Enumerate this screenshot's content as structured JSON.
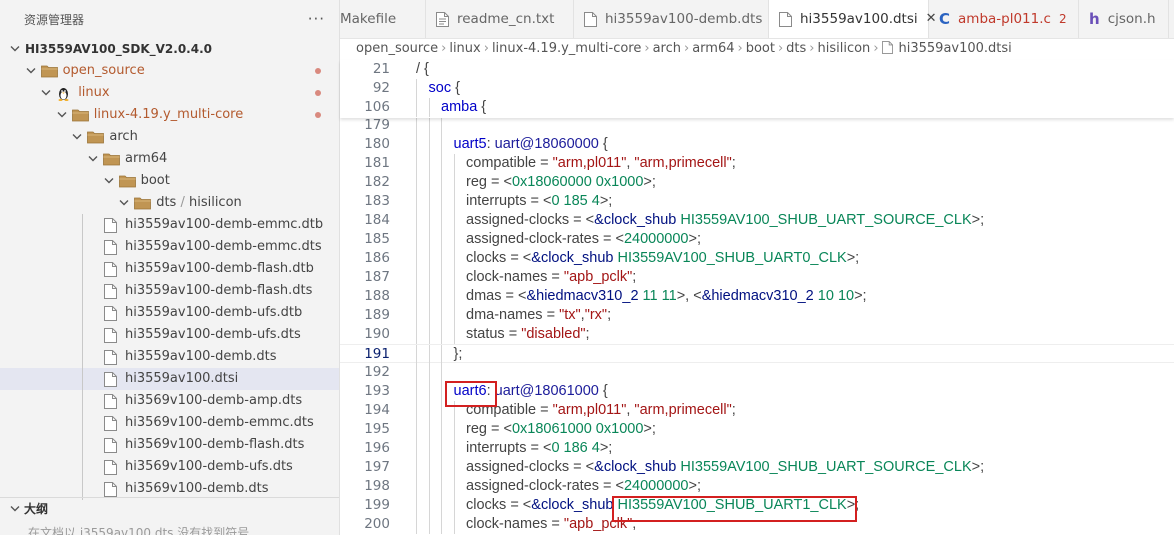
{
  "sidebar": {
    "title": "资源管理器",
    "more": "···",
    "tree": [
      {
        "label": "HI3559AV100_SDK_V2.0.4.0",
        "level": 0,
        "type": "root",
        "expanded": true
      },
      {
        "label": "open_source",
        "level": 1,
        "type": "folder",
        "expanded": true,
        "modified": true
      },
      {
        "label": "linux",
        "level": 2,
        "type": "linux",
        "expanded": true,
        "modified": true
      },
      {
        "label": "linux-4.19.y_multi-core",
        "level": 3,
        "type": "folder",
        "expanded": true,
        "modified": true
      },
      {
        "label": "arch",
        "level": 4,
        "type": "folder",
        "expanded": true
      },
      {
        "label": "arm64",
        "level": 5,
        "type": "folder",
        "expanded": true
      },
      {
        "label": "boot",
        "level": 6,
        "type": "folder",
        "expanded": true
      },
      {
        "label": "dts",
        "label2": "hisilicon",
        "level": 7,
        "type": "folder",
        "expanded": true
      },
      {
        "label": "hi3559av100-demb-emmc.dtb",
        "level": 8,
        "type": "file"
      },
      {
        "label": "hi3559av100-demb-emmc.dts",
        "level": 8,
        "type": "file"
      },
      {
        "label": "hi3559av100-demb-flash.dtb",
        "level": 8,
        "type": "file"
      },
      {
        "label": "hi3559av100-demb-flash.dts",
        "level": 8,
        "type": "file"
      },
      {
        "label": "hi3559av100-demb-ufs.dtb",
        "level": 8,
        "type": "file"
      },
      {
        "label": "hi3559av100-demb-ufs.dts",
        "level": 8,
        "type": "file"
      },
      {
        "label": "hi3559av100-demb.dts",
        "level": 8,
        "type": "file"
      },
      {
        "label": "hi3559av100.dtsi",
        "level": 8,
        "type": "file",
        "selected": true
      },
      {
        "label": "hi3569v100-demb-amp.dts",
        "level": 8,
        "type": "file"
      },
      {
        "label": "hi3569v100-demb-emmc.dts",
        "level": 8,
        "type": "file"
      },
      {
        "label": "hi3569v100-demb-flash.dts",
        "level": 8,
        "type": "file"
      },
      {
        "label": "hi3569v100-demb-ufs.dts",
        "level": 8,
        "type": "file"
      },
      {
        "label": "hi3569v100-demb.dts",
        "level": 8,
        "type": "file"
      }
    ]
  },
  "outline": {
    "title": "大纲",
    "text": "在文档以 i3559av100.dts 没有找到符号"
  },
  "tabs": [
    {
      "label": "Makefile",
      "kind": "plain"
    },
    {
      "label": "readme_cn.txt",
      "kind": "text"
    },
    {
      "label": "hi3559av100-demb.dts",
      "kind": "file"
    },
    {
      "label": "hi3559av100.dtsi",
      "kind": "file",
      "active": true
    },
    {
      "label": "amba-pl011.c",
      "kind": "c",
      "badge": "2"
    },
    {
      "label": "cjson.h",
      "kind": "h"
    }
  ],
  "breadcrumb": [
    "open_source",
    "linux",
    "linux-4.19.y_multi-core",
    "arch",
    "arm64",
    "boot",
    "dts",
    "hisilicon",
    "hi3559av100.dtsi"
  ],
  "colors": {
    "accent": "#0000c8",
    "string": "#a31515",
    "number": "#098658",
    "highlight_box": "#d32020",
    "modified": "#b35a2e"
  },
  "sticky_lines": [
    {
      "num": "21",
      "indent": 0,
      "tokens": [
        [
          "p",
          "/ {"
        ]
      ]
    },
    {
      "num": "92",
      "indent": 1,
      "tokens": [
        [
          "k",
          "soc"
        ],
        [
          "p",
          " {"
        ]
      ]
    },
    {
      "num": "106",
      "indent": 2,
      "tokens": [
        [
          "k",
          "amba"
        ],
        [
          "p",
          " {"
        ]
      ]
    }
  ],
  "code_lines": [
    {
      "num": "179",
      "indent": 3,
      "tokens": []
    },
    {
      "num": "180",
      "indent": 3,
      "tokens": [
        [
          "k",
          "uart5"
        ],
        [
          "p",
          ": "
        ],
        [
          "n",
          "uart@18060000"
        ],
        [
          "p",
          " {"
        ]
      ]
    },
    {
      "num": "181",
      "indent": 4,
      "tokens": [
        [
          "p",
          "compatible = "
        ],
        [
          "s",
          "\"arm,pl011\""
        ],
        [
          "p",
          ", "
        ],
        [
          "s",
          "\"arm,primecell\""
        ],
        [
          "p",
          ";"
        ]
      ]
    },
    {
      "num": "182",
      "indent": 4,
      "tokens": [
        [
          "p",
          "reg = <"
        ],
        [
          "num",
          "0x18060000 0x1000"
        ],
        [
          "p",
          ">;"
        ]
      ]
    },
    {
      "num": "183",
      "indent": 4,
      "tokens": [
        [
          "p",
          "interrupts = <"
        ],
        [
          "num",
          "0 185 4"
        ],
        [
          "p",
          ">;"
        ]
      ]
    },
    {
      "num": "184",
      "indent": 4,
      "tokens": [
        [
          "p",
          "assigned-clocks = <"
        ],
        [
          "lbl",
          "&clock_shub"
        ],
        [
          "p",
          " "
        ],
        [
          "num",
          "HI3559AV100_SHUB_UART_SOURCE_CLK"
        ],
        [
          "p",
          ">;"
        ]
      ]
    },
    {
      "num": "185",
      "indent": 4,
      "tokens": [
        [
          "p",
          "assigned-clock-rates = <"
        ],
        [
          "num",
          "24000000"
        ],
        [
          "p",
          ">;"
        ]
      ]
    },
    {
      "num": "186",
      "indent": 4,
      "tokens": [
        [
          "p",
          "clocks = <"
        ],
        [
          "lbl",
          "&clock_shub"
        ],
        [
          "p",
          " "
        ],
        [
          "num",
          "HI3559AV100_SHUB_UART0_CLK"
        ],
        [
          "p",
          ">;"
        ]
      ]
    },
    {
      "num": "187",
      "indent": 4,
      "tokens": [
        [
          "p",
          "clock-names = "
        ],
        [
          "s",
          "\"apb_pclk\""
        ],
        [
          "p",
          ";"
        ]
      ]
    },
    {
      "num": "188",
      "indent": 4,
      "tokens": [
        [
          "p",
          "dmas = <"
        ],
        [
          "lbl",
          "&hiedmacv310_2"
        ],
        [
          "p",
          " "
        ],
        [
          "num",
          "11 11"
        ],
        [
          "p",
          ">, <"
        ],
        [
          "lbl",
          "&hiedmacv310_2"
        ],
        [
          "p",
          " "
        ],
        [
          "num",
          "10 10"
        ],
        [
          "p",
          ">;"
        ]
      ]
    },
    {
      "num": "189",
      "indent": 4,
      "tokens": [
        [
          "p",
          "dma-names = "
        ],
        [
          "s",
          "\"tx\""
        ],
        [
          "p",
          ","
        ],
        [
          "s",
          "\"rx\""
        ],
        [
          "p",
          ";"
        ]
      ]
    },
    {
      "num": "190",
      "indent": 4,
      "tokens": [
        [
          "p",
          "status = "
        ],
        [
          "s",
          "\"disabled\""
        ],
        [
          "p",
          ";"
        ]
      ]
    },
    {
      "num": "191",
      "indent": 3,
      "tokens": [
        [
          "p",
          "};"
        ]
      ],
      "current": true
    },
    {
      "num": "192",
      "indent": 3,
      "tokens": []
    },
    {
      "num": "193",
      "indent": 3,
      "tokens": [
        [
          "k",
          "uart6"
        ],
        [
          "p",
          ": "
        ],
        [
          "n",
          "uart@18061000"
        ],
        [
          "p",
          " {"
        ]
      ]
    },
    {
      "num": "194",
      "indent": 4,
      "tokens": [
        [
          "p",
          "compatible = "
        ],
        [
          "s",
          "\"arm,pl011\""
        ],
        [
          "p",
          ", "
        ],
        [
          "s",
          "\"arm,primecell\""
        ],
        [
          "p",
          ";"
        ]
      ]
    },
    {
      "num": "195",
      "indent": 4,
      "tokens": [
        [
          "p",
          "reg = <"
        ],
        [
          "num",
          "0x18061000 0x1000"
        ],
        [
          "p",
          ">;"
        ]
      ]
    },
    {
      "num": "196",
      "indent": 4,
      "tokens": [
        [
          "p",
          "interrupts = <"
        ],
        [
          "num",
          "0 186 4"
        ],
        [
          "p",
          ">;"
        ]
      ]
    },
    {
      "num": "197",
      "indent": 4,
      "tokens": [
        [
          "p",
          "assigned-clocks = <"
        ],
        [
          "lbl",
          "&clock_shub"
        ],
        [
          "p",
          " "
        ],
        [
          "num",
          "HI3559AV100_SHUB_UART_SOURCE_CLK"
        ],
        [
          "p",
          ">;"
        ]
      ]
    },
    {
      "num": "198",
      "indent": 4,
      "tokens": [
        [
          "p",
          "assigned-clock-rates = <"
        ],
        [
          "num",
          "24000000"
        ],
        [
          "p",
          ">;"
        ]
      ]
    },
    {
      "num": "199",
      "indent": 4,
      "tokens": [
        [
          "p",
          "clocks = <"
        ],
        [
          "lbl",
          "&clock_shub"
        ],
        [
          "p",
          " "
        ],
        [
          "num",
          "HI3559AV100_SHUB_UART1_CLK"
        ],
        [
          "p",
          ">;"
        ]
      ]
    },
    {
      "num": "200",
      "indent": 4,
      "tokens": [
        [
          "p",
          "clock-names = "
        ],
        [
          "s",
          "\"apb_pclk\""
        ],
        [
          "p",
          ";"
        ]
      ]
    }
  ]
}
